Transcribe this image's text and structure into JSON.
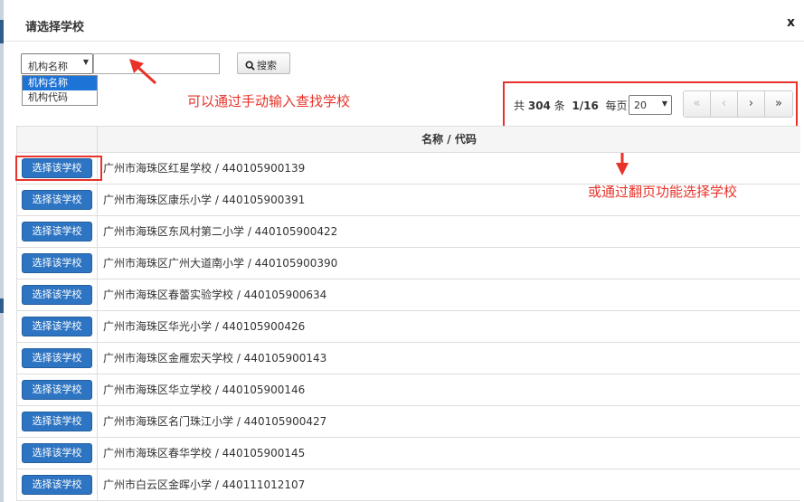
{
  "modal": {
    "title": "请选择学校",
    "close_label": "x"
  },
  "search": {
    "field_select_value": "机构名称",
    "field_options": [
      "机构名称",
      "机构代码"
    ],
    "input_value": "",
    "button_label": "搜索"
  },
  "annotations": {
    "search_hint": "可以通过手动输入查找学校",
    "pager_hint": "或通过翻页功能选择学校"
  },
  "pager": {
    "total_prefix": "共",
    "total": "304",
    "total_suffix": "条",
    "page": "1/16",
    "per_page_label": "每页",
    "per_page_value": "20",
    "first": "«",
    "prev": "‹",
    "next": "›",
    "last": "»"
  },
  "table": {
    "header": "名称 / 代码",
    "select_label": "选择该学校",
    "rows": [
      "广州市海珠区红星学校 / 440105900139",
      "广州市海珠区康乐小学 / 440105900391",
      "广州市海珠区东风村第二小学 / 440105900422",
      "广州市海珠区广州大道南小学 / 440105900390",
      "广州市海珠区春蕾实验学校 / 440105900634",
      "广州市海珠区华光小学 / 440105900426",
      "广州市海珠区金雁宏天学校 / 440105900143",
      "广州市海珠区华立学校 / 440105900146",
      "广州市海珠区名门珠江小学 / 440105900427",
      "广州市海珠区春华学校 / 440105900145",
      "广州市白云区金晖小学 / 440111012107"
    ]
  },
  "colors": {
    "accent_button": "#2d74c2",
    "annotation_red": "#e8322a",
    "dropdown_selected": "#1e73d6"
  }
}
